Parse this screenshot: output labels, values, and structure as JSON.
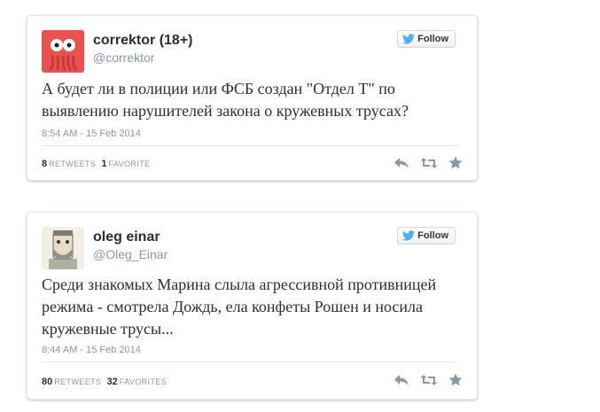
{
  "tweets": [
    {
      "display_name": "correktor (18+)",
      "handle": "@correktor",
      "follow_label": "Follow",
      "text": "А будет ли в полиции или ФСБ создан \"Отдел Т\" по выявлению нарушителей закона о кружевных трусах?",
      "timestamp": "8:54 AM - 15 Feb 2014",
      "retweets_count": "8",
      "retweets_label": "RETWEETS",
      "favorites_count": "1",
      "favorites_label": "FAVORITE",
      "avatar_color": "#e8524f"
    },
    {
      "display_name": "oleg einar",
      "handle": "@Oleg_Einar",
      "follow_label": "Follow",
      "text": "Среди знакомых Марина слыла агрессивной противницей режима - смотрела Дождь, ела конфеты Рошен и носила кружевные трусы...",
      "timestamp": "8:44 AM - 15 Feb 2014",
      "retweets_count": "80",
      "retweets_label": "RETWEETS",
      "favorites_count": "32",
      "favorites_label": "FAVORITES",
      "avatar_color": "#f3efe4"
    }
  ],
  "colors": {
    "twitter_blue": "#55acee",
    "text_dark": "#292f33",
    "text_muted": "#8899a6",
    "icon_gray": "#8899a6"
  },
  "icons": [
    "twitter-bird-icon",
    "reply-icon",
    "retweet-icon",
    "favorite-star-icon"
  ]
}
